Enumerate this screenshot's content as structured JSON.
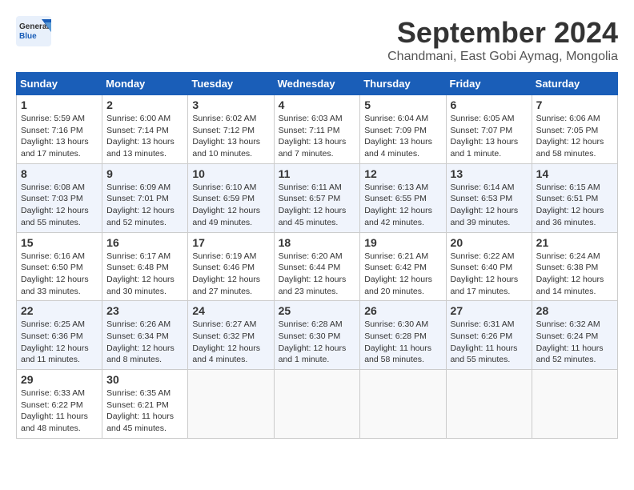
{
  "header": {
    "logo_line1": "General",
    "logo_line2": "Blue",
    "month_title": "September 2024",
    "subtitle": "Chandmani, East Gobi Aymag, Mongolia"
  },
  "weekdays": [
    "Sunday",
    "Monday",
    "Tuesday",
    "Wednesday",
    "Thursday",
    "Friday",
    "Saturday"
  ],
  "weeks": [
    [
      {
        "day": "1",
        "info": "Sunrise: 5:59 AM\nSunset: 7:16 PM\nDaylight: 13 hours\nand 17 minutes."
      },
      {
        "day": "2",
        "info": "Sunrise: 6:00 AM\nSunset: 7:14 PM\nDaylight: 13 hours\nand 13 minutes."
      },
      {
        "day": "3",
        "info": "Sunrise: 6:02 AM\nSunset: 7:12 PM\nDaylight: 13 hours\nand 10 minutes."
      },
      {
        "day": "4",
        "info": "Sunrise: 6:03 AM\nSunset: 7:11 PM\nDaylight: 13 hours\nand 7 minutes."
      },
      {
        "day": "5",
        "info": "Sunrise: 6:04 AM\nSunset: 7:09 PM\nDaylight: 13 hours\nand 4 minutes."
      },
      {
        "day": "6",
        "info": "Sunrise: 6:05 AM\nSunset: 7:07 PM\nDaylight: 13 hours\nand 1 minute."
      },
      {
        "day": "7",
        "info": "Sunrise: 6:06 AM\nSunset: 7:05 PM\nDaylight: 12 hours\nand 58 minutes."
      }
    ],
    [
      {
        "day": "8",
        "info": "Sunrise: 6:08 AM\nSunset: 7:03 PM\nDaylight: 12 hours\nand 55 minutes."
      },
      {
        "day": "9",
        "info": "Sunrise: 6:09 AM\nSunset: 7:01 PM\nDaylight: 12 hours\nand 52 minutes."
      },
      {
        "day": "10",
        "info": "Sunrise: 6:10 AM\nSunset: 6:59 PM\nDaylight: 12 hours\nand 49 minutes."
      },
      {
        "day": "11",
        "info": "Sunrise: 6:11 AM\nSunset: 6:57 PM\nDaylight: 12 hours\nand 45 minutes."
      },
      {
        "day": "12",
        "info": "Sunrise: 6:13 AM\nSunset: 6:55 PM\nDaylight: 12 hours\nand 42 minutes."
      },
      {
        "day": "13",
        "info": "Sunrise: 6:14 AM\nSunset: 6:53 PM\nDaylight: 12 hours\nand 39 minutes."
      },
      {
        "day": "14",
        "info": "Sunrise: 6:15 AM\nSunset: 6:51 PM\nDaylight: 12 hours\nand 36 minutes."
      }
    ],
    [
      {
        "day": "15",
        "info": "Sunrise: 6:16 AM\nSunset: 6:50 PM\nDaylight: 12 hours\nand 33 minutes."
      },
      {
        "day": "16",
        "info": "Sunrise: 6:17 AM\nSunset: 6:48 PM\nDaylight: 12 hours\nand 30 minutes."
      },
      {
        "day": "17",
        "info": "Sunrise: 6:19 AM\nSunset: 6:46 PM\nDaylight: 12 hours\nand 27 minutes."
      },
      {
        "day": "18",
        "info": "Sunrise: 6:20 AM\nSunset: 6:44 PM\nDaylight: 12 hours\nand 23 minutes."
      },
      {
        "day": "19",
        "info": "Sunrise: 6:21 AM\nSunset: 6:42 PM\nDaylight: 12 hours\nand 20 minutes."
      },
      {
        "day": "20",
        "info": "Sunrise: 6:22 AM\nSunset: 6:40 PM\nDaylight: 12 hours\nand 17 minutes."
      },
      {
        "day": "21",
        "info": "Sunrise: 6:24 AM\nSunset: 6:38 PM\nDaylight: 12 hours\nand 14 minutes."
      }
    ],
    [
      {
        "day": "22",
        "info": "Sunrise: 6:25 AM\nSunset: 6:36 PM\nDaylight: 12 hours\nand 11 minutes."
      },
      {
        "day": "23",
        "info": "Sunrise: 6:26 AM\nSunset: 6:34 PM\nDaylight: 12 hours\nand 8 minutes."
      },
      {
        "day": "24",
        "info": "Sunrise: 6:27 AM\nSunset: 6:32 PM\nDaylight: 12 hours\nand 4 minutes."
      },
      {
        "day": "25",
        "info": "Sunrise: 6:28 AM\nSunset: 6:30 PM\nDaylight: 12 hours\nand 1 minute."
      },
      {
        "day": "26",
        "info": "Sunrise: 6:30 AM\nSunset: 6:28 PM\nDaylight: 11 hours\nand 58 minutes."
      },
      {
        "day": "27",
        "info": "Sunrise: 6:31 AM\nSunset: 6:26 PM\nDaylight: 11 hours\nand 55 minutes."
      },
      {
        "day": "28",
        "info": "Sunrise: 6:32 AM\nSunset: 6:24 PM\nDaylight: 11 hours\nand 52 minutes."
      }
    ],
    [
      {
        "day": "29",
        "info": "Sunrise: 6:33 AM\nSunset: 6:22 PM\nDaylight: 11 hours\nand 48 minutes."
      },
      {
        "day": "30",
        "info": "Sunrise: 6:35 AM\nSunset: 6:21 PM\nDaylight: 11 hours\nand 45 minutes."
      },
      {
        "day": "",
        "info": ""
      },
      {
        "day": "",
        "info": ""
      },
      {
        "day": "",
        "info": ""
      },
      {
        "day": "",
        "info": ""
      },
      {
        "day": "",
        "info": ""
      }
    ]
  ]
}
